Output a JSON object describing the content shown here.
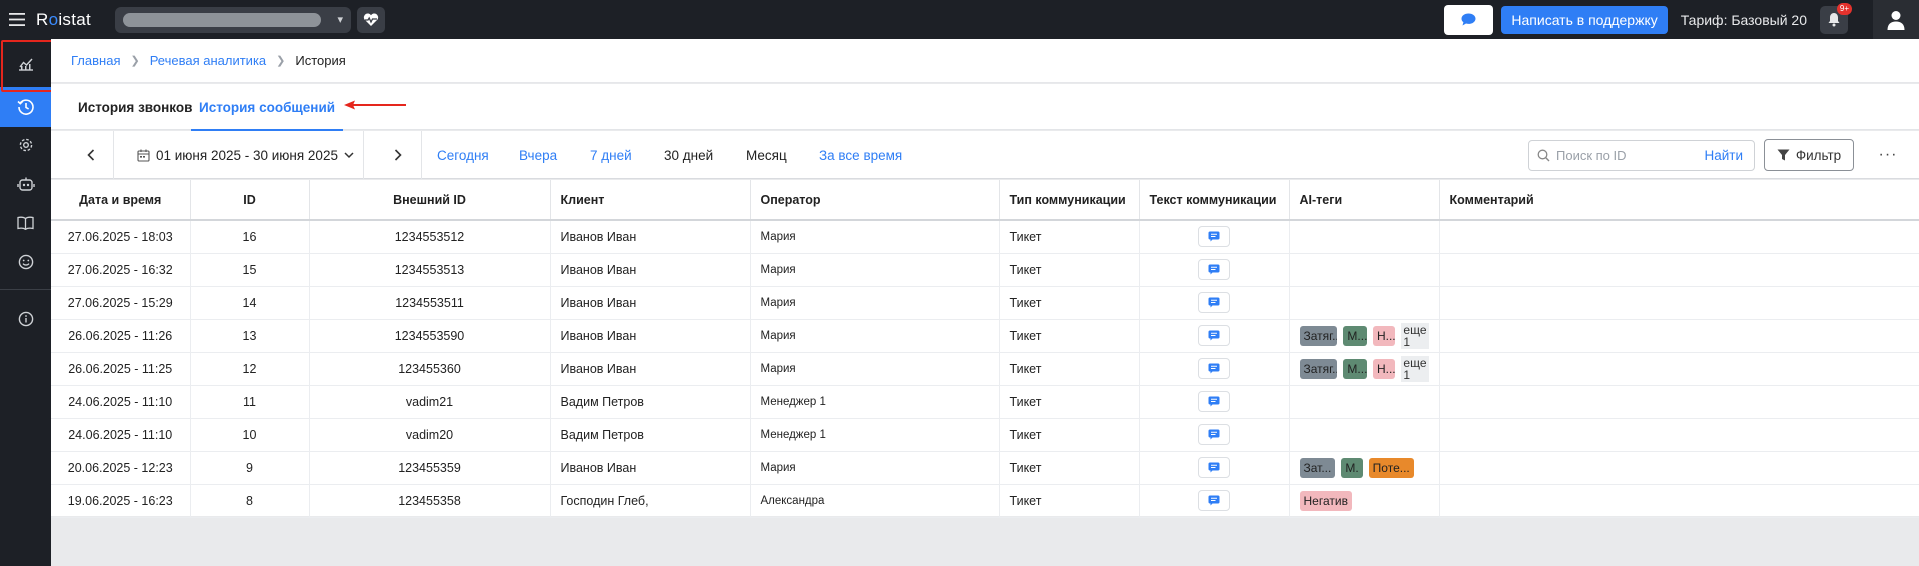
{
  "app": {
    "logo_left": "R",
    "logo_dot": "o",
    "logo_right": "istat"
  },
  "header": {
    "support_label": "Написать в поддержку",
    "tariff_label": "Тариф: Базовый 20",
    "notifications_badge": "9+"
  },
  "breadcrumb": [
    {
      "label": "Главная"
    },
    {
      "label": "Речевая аналитика"
    },
    {
      "label": "История"
    }
  ],
  "tabs": {
    "calls": "История звонков",
    "messages": "История сообщений",
    "active": "messages"
  },
  "filters": {
    "date_range": "01 июня 2025 - 30 июня 2025",
    "periods": [
      "Сегодня",
      "Вчера",
      "7 дней",
      "30 дней",
      "Месяц",
      "За все время"
    ],
    "search_placeholder": "Поиск по ID",
    "search_button": "Найти",
    "filter_button": "Фильтр",
    "more": "···"
  },
  "table": {
    "columns": [
      "Дата и время",
      "ID",
      "Внешний ID",
      "Клиент",
      "Оператор",
      "Тип коммуникации",
      "Текст коммуникации",
      "AI-теги",
      "Комментарий"
    ],
    "rows": [
      {
        "datetime": "27.06.2025 - 18:03",
        "id": "16",
        "ext_id": "1234553512",
        "client": "Иванов Иван",
        "operator": "Мария",
        "type": "Тикет",
        "tags": [],
        "comment": ""
      },
      {
        "datetime": "27.06.2025 - 16:32",
        "id": "15",
        "ext_id": "1234553513",
        "client": "Иванов Иван",
        "operator": "Мария",
        "type": "Тикет",
        "tags": [],
        "comment": ""
      },
      {
        "datetime": "27.06.2025 - 15:29",
        "id": "14",
        "ext_id": "1234553511",
        "client": "Иванов Иван",
        "operator": "Мария",
        "type": "Тикет",
        "tags": [],
        "comment": ""
      },
      {
        "datetime": "26.06.2025 - 11:26",
        "id": "13",
        "ext_id": "1234553590",
        "client": "Иванов Иван",
        "operator": "Мария",
        "type": "Тикет",
        "tags": [
          {
            "label": "Затяг...",
            "color": "gray"
          },
          {
            "label": "М...",
            "color": "green"
          },
          {
            "label": "Н...",
            "color": "pink"
          }
        ],
        "more": "еще 1",
        "comment": ""
      },
      {
        "datetime": "26.06.2025 - 11:25",
        "id": "12",
        "ext_id": "123455360",
        "client": "Иванов Иван",
        "operator": "Мария",
        "type": "Тикет",
        "tags": [
          {
            "label": "Затяг...",
            "color": "gray"
          },
          {
            "label": "М...",
            "color": "green"
          },
          {
            "label": "Н...",
            "color": "pink"
          }
        ],
        "more": "еще 1",
        "comment": ""
      },
      {
        "datetime": "24.06.2025 - 11:10",
        "id": "11",
        "ext_id": "vadim21",
        "client": "Вадим Петров",
        "operator": "Менеджер 1",
        "type": "Тикет",
        "tags": [],
        "comment": ""
      },
      {
        "datetime": "24.06.2025 - 11:10",
        "id": "10",
        "ext_id": "vadim20",
        "client": "Вадим Петров",
        "operator": "Менеджер 1",
        "type": "Тикет",
        "tags": [],
        "comment": ""
      },
      {
        "datetime": "20.06.2025 - 12:23",
        "id": "9",
        "ext_id": "123455359",
        "client": "Иванов Иван",
        "operator": "Мария",
        "type": "Тикет",
        "tags": [
          {
            "label": "Зат...",
            "color": "gray"
          },
          {
            "label": "М.",
            "color": "green"
          },
          {
            "label": "Поте...",
            "color": "orange"
          }
        ],
        "comment": ""
      },
      {
        "datetime": "19.06.2025 - 16:23",
        "id": "8",
        "ext_id": "123455358",
        "client": "Господин Глеб,",
        "operator": "Александра",
        "type": "Тикет",
        "tags": [
          {
            "label": "Негатив",
            "color": "pink"
          }
        ],
        "comment": ""
      }
    ]
  },
  "colors": {
    "accent": "#2f7ef5",
    "topbar": "#1d2026",
    "highlight": "#e5261d"
  }
}
